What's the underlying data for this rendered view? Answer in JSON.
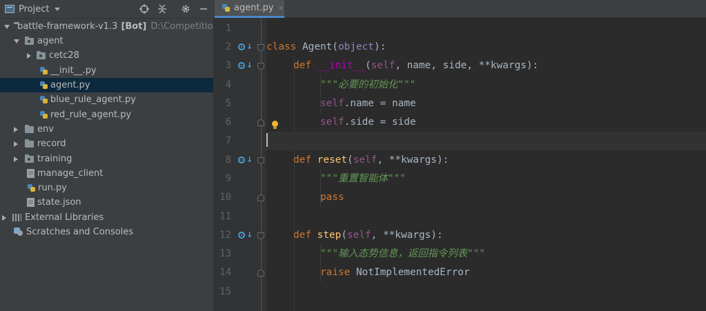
{
  "sidebar": {
    "title": "Project",
    "toolbar_icons": [
      "target-icon",
      "collapse-all-icon",
      "gear-icon",
      "minimize-icon"
    ],
    "tree": [
      {
        "label": "battle-framework-v1.3",
        "extra": "[Bot]",
        "path": "D:\\Competition\\",
        "icon": "folder-icon",
        "expanded": true
      },
      {
        "label": "agent",
        "icon": "package-folder-icon",
        "expanded": true
      },
      {
        "label": "cetc28",
        "icon": "package-folder-icon",
        "expanded": false
      },
      {
        "label": "__init__.py",
        "icon": "python-file-icon"
      },
      {
        "label": "agent.py",
        "icon": "python-file-icon",
        "selected": true
      },
      {
        "label": "blue_rule_agent.py",
        "icon": "python-file-icon"
      },
      {
        "label": "red_rule_agent.py",
        "icon": "python-file-icon"
      },
      {
        "label": "env",
        "icon": "folder-icon",
        "expanded": false
      },
      {
        "label": "record",
        "icon": "folder-icon",
        "expanded": false
      },
      {
        "label": "training",
        "icon": "package-folder-icon",
        "expanded": false
      },
      {
        "label": "manage_client",
        "icon": "file-icon"
      },
      {
        "label": "run.py",
        "icon": "python-file-icon"
      },
      {
        "label": "state.json",
        "icon": "json-file-icon"
      },
      {
        "label": "External Libraries",
        "icon": "libraries-icon",
        "expanded": false
      },
      {
        "label": "Scratches and Consoles",
        "icon": "scratches-icon"
      }
    ]
  },
  "editor": {
    "tab_label": "agent.py",
    "tab_close": "×",
    "line_numbers": [
      "1",
      "2",
      "3",
      "4",
      "5",
      "6",
      "7",
      "8",
      "9",
      "10",
      "11",
      "12",
      "13",
      "14",
      "15"
    ],
    "code": {
      "l2_class": "class",
      "l2_name": " Agent(",
      "l2_base": "object",
      "l2_end": "):",
      "def": "def",
      "init_name": "__init__",
      "self": "self",
      "init_params": ", name, side, **kwargs):",
      "init_doc": "\"\"\"必要的初始化\"\"\"",
      "l5_attr": ".name = name",
      "l6_attr": ".side = side",
      "reset_name": "reset",
      "reset_params": ", **kwargs):",
      "reset_doc": "\"\"\"重置智能体\"\"\"",
      "pass": "pass",
      "step_name": "step",
      "step_params": ", **kwargs):",
      "step_doc": "\"\"\"输入态势信息，返回指令列表\"\"\"",
      "raise": "raise",
      "raise_err": " NotImplementedError"
    }
  }
}
